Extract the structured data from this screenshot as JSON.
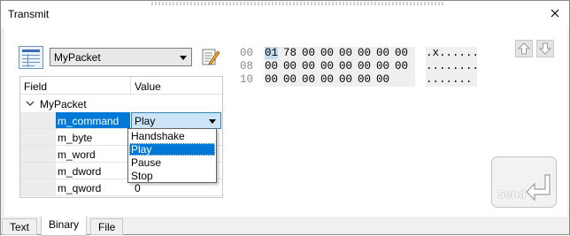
{
  "window": {
    "title": "Transmit"
  },
  "toolbar": {
    "struct_type": "MyPacket"
  },
  "grid": {
    "header_field": "Field",
    "header_value": "Value",
    "node_label": "MyPacket",
    "rows": [
      {
        "name": "m_command",
        "value": "Play"
      },
      {
        "name": "m_byte",
        "value": ""
      },
      {
        "name": "m_word",
        "value": ""
      },
      {
        "name": "m_dword",
        "value": ""
      },
      {
        "name": "m_qword",
        "value": "0"
      }
    ]
  },
  "dropdown": {
    "options": [
      "Handshake",
      "Play",
      "Pause",
      "Stop"
    ],
    "selected": "Play"
  },
  "hex": {
    "rows": [
      {
        "offset": "00",
        "bytes": [
          "01",
          "78",
          "00",
          "00",
          "00",
          "00",
          "00",
          "00"
        ],
        "ascii": ".x......"
      },
      {
        "offset": "08",
        "bytes": [
          "00",
          "00",
          "00",
          "00",
          "00",
          "00",
          "00",
          "00"
        ],
        "ascii": "........"
      },
      {
        "offset": "10",
        "bytes": [
          "00",
          "00",
          "00",
          "00",
          "00",
          "00",
          "00"
        ],
        "ascii": "......."
      }
    ]
  },
  "send": {
    "label": "Send"
  },
  "tabs": [
    "Text",
    "Binary",
    "File"
  ],
  "colors": {
    "selection": "#0078d7",
    "hex_highlight": "#c5d9f1"
  },
  "icons": [
    "close-icon",
    "struct-view-icon",
    "edit-icon",
    "arrow-up-icon",
    "arrow-down-icon",
    "enter-arrow-icon",
    "chevron-down-icon"
  ]
}
